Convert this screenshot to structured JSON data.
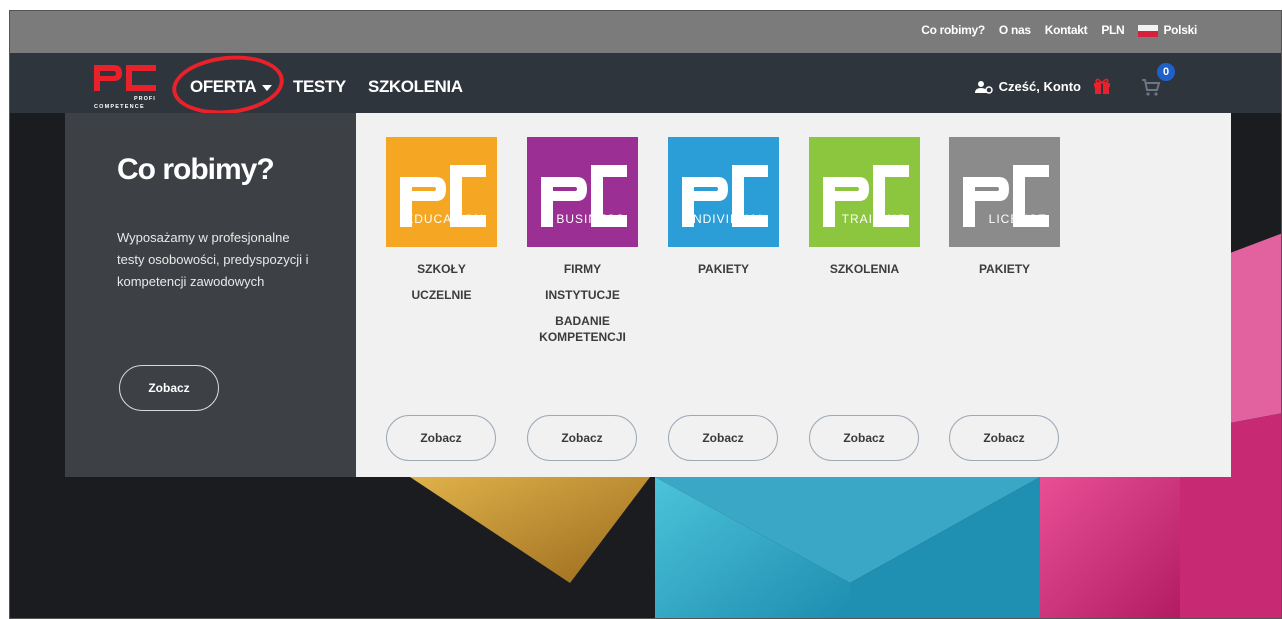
{
  "topbar": {
    "links": [
      "Co robimy?",
      "O nas",
      "Kontakt",
      "PLN"
    ],
    "language": "Polski"
  },
  "nav": {
    "logo_text": "PC",
    "logo_sub1": "PROFI",
    "logo_sub2": "COMPETENCE",
    "oferta": "OFERTA",
    "testy": "TESTY",
    "szkolenia": "SZKOLENIA",
    "account": "Cześć, Konto",
    "cart_count": "0"
  },
  "dropdown": {
    "title": "Co robimy?",
    "description": "Wyposażamy w profesjonalne testy osobowości, predyspozycji i kompetencji zawodowych",
    "button": "Zobacz",
    "cards": [
      {
        "brand": "PC",
        "label": "EDUCATION",
        "color": "#f5a623",
        "items": [
          "SZKOŁY",
          "UCZELNIE"
        ],
        "button": "Zobacz"
      },
      {
        "brand": "PC",
        "label": "BUSINESS",
        "color": "#9b2f94",
        "items": [
          "FIRMY",
          "INSTYTUCJE",
          "BADANIE KOMPETENCJI"
        ],
        "button": "Zobacz"
      },
      {
        "brand": "PC",
        "label": "INDIVIDUAL",
        "color": "#2b9ed8",
        "items": [
          "PAKIETY"
        ],
        "button": "Zobacz"
      },
      {
        "brand": "PC",
        "label": "TRAINING",
        "color": "#8cc63f",
        "items": [
          "SZKOLENIA"
        ],
        "button": "Zobacz"
      },
      {
        "brand": "PC",
        "label": "LICENSE",
        "color": "#8b8b8b",
        "items": [
          "PAKIETY"
        ],
        "button": "Zobacz"
      }
    ]
  },
  "colors": {
    "topbar": "#7b7b7b",
    "navbar": "#2f353c",
    "accent_red": "#e8212b",
    "badge_blue": "#1e62c9"
  }
}
